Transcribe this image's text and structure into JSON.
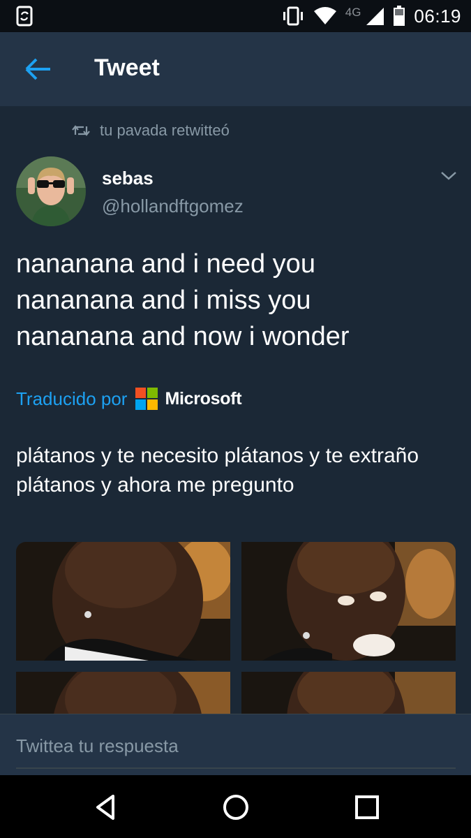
{
  "status_bar": {
    "network": "4G",
    "time": "06:19",
    "icons": [
      "phone-sync-icon",
      "vibrate-icon",
      "wifi-icon",
      "cell-signal-icon",
      "battery-icon"
    ]
  },
  "app_bar": {
    "title": "Tweet",
    "back_icon": "arrow-left-icon"
  },
  "tweet": {
    "retweet_label": "tu pavada retwitteó",
    "author": {
      "display_name": "sebas",
      "handle": "@hollandftgomez"
    },
    "text_lines": [
      "nananana and i need you",
      "nananana and i miss you",
      "nananana and now i wonder"
    ],
    "translated_by": "Traducido por",
    "translator_name": "Microsoft",
    "translation": "plátanos y te necesito plátanos y te extraño plátanos y ahora me pregunto",
    "media_count": 4
  },
  "reply": {
    "placeholder": "Twittea tu respuesta"
  },
  "colors": {
    "background": "#1b2836",
    "app_bar": "#243447",
    "accent": "#1da1f2",
    "secondary_text": "#8899a6",
    "ms_red": "#f25022",
    "ms_green": "#7fba00",
    "ms_blue": "#00a4ef",
    "ms_yellow": "#ffb900"
  }
}
